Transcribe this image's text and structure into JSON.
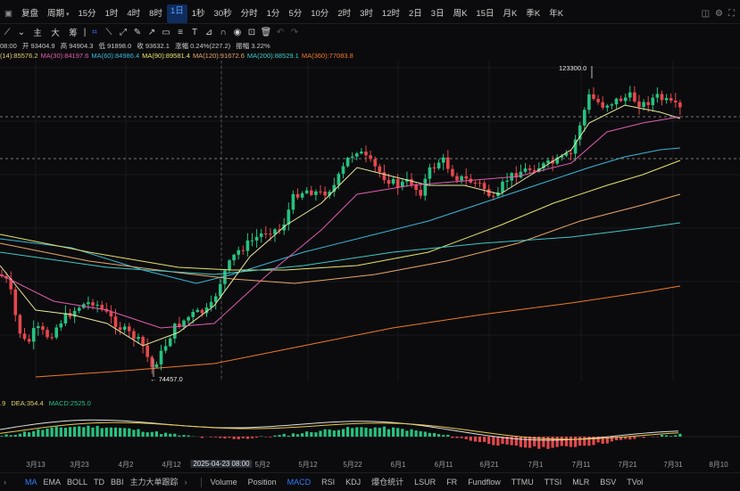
{
  "toolbar": {
    "left_icon": "▣",
    "mode_label": "复盘",
    "period_label": "周期",
    "timeframes": [
      "15分",
      "1时",
      "4时",
      "8时",
      "1日",
      "1秒",
      "30秒",
      "分时",
      "1分",
      "5分",
      "10分",
      "2时",
      "3时",
      "12时",
      "2日",
      "3日",
      "周K",
      "15日",
      "月K",
      "季K",
      "年K"
    ],
    "active_timeframe": "1日"
  },
  "drawbar": {
    "items": [
      "主",
      "大",
      "筹"
    ]
  },
  "ohlc": {
    "time": "08:00",
    "open": "开 93404.9",
    "high": "高 94904.3",
    "low": "低 91898.0",
    "close": "收 93632.1",
    "change": "涨幅 0.24%(227.2)",
    "amplitude": "振幅 3.22%"
  },
  "ma_legend": [
    {
      "text": "(14):85576.2",
      "color": "#e0d070"
    },
    {
      "text": "MA(30):84197.6",
      "color": "#e25bb0"
    },
    {
      "text": "MA(60):84986.4",
      "color": "#3ab7d8"
    },
    {
      "text": "MA(90):89581.4",
      "color": "#e6e36a"
    },
    {
      "text": "MA(120):91672.6",
      "color": "#e9a86a"
    },
    {
      "text": "MA(200):88529.1",
      "color": "#41c9c9"
    },
    {
      "text": "MA(360):77083.8",
      "color": "#f07a2a"
    }
  ],
  "price_labels": {
    "high": "123300.0",
    "low": "74457.0"
  },
  "macd_header": {
    "dif": ".9",
    "dea": "DEA:354.4",
    "macd": "MACD:2525.0"
  },
  "xaxis": {
    "labels": [
      "3月13",
      "3月23",
      "4月2",
      "4月12",
      "2025-04-23 08:00",
      "5月2",
      "5月12",
      "5月22",
      "6月1",
      "6月11",
      "6月21",
      "7月1",
      "7月11",
      "7月21",
      "7月31",
      "8月10"
    ],
    "highlighted": "2025-04-23 08:00"
  },
  "indicators": {
    "main": [
      "MA",
      "EMA",
      "BOLL",
      "TD",
      "BBI",
      "主力大单跟踪"
    ],
    "sub": [
      "Volume",
      "Position",
      "MACD",
      "RSI",
      "KDJ",
      "爆仓统计",
      "LSUR",
      "FR",
      "Fundflow",
      "TTMU",
      "TTSI",
      "MLR",
      "BSV",
      "TVol"
    ],
    "active_main": "MA",
    "active_sub": "MACD"
  },
  "colors": {
    "up": "#26c281",
    "down": "#e5484d",
    "accent": "#2f7cf6"
  }
}
